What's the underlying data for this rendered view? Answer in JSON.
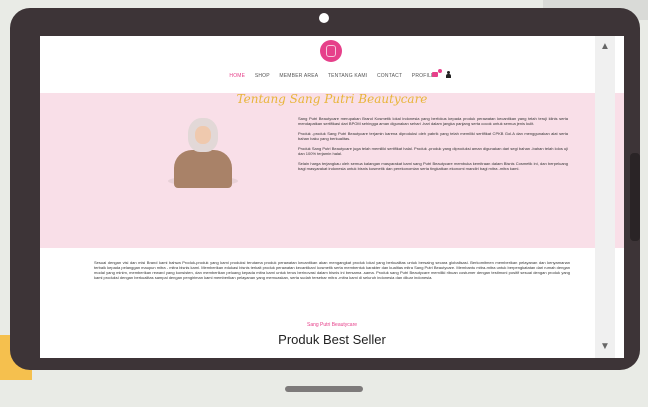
{
  "nav": {
    "items": [
      "HOME",
      "SHOP",
      "MEMBER AREA",
      "TENTANG KAMI",
      "CONTACT",
      "PROFILE"
    ],
    "active_index": 0
  },
  "about": {
    "title": "Tentang Sang Putri Beautycare",
    "paragraphs": [
      "Sang Putri Beautycare merupakan Brand Kosmetik lokal indonesia yang berfokus kepada produk perawatan kecantikan yang telah teruji klinis serta mendapatkan sertifikasi dari BPOM sehingga aman digunakan sehari -hari dalam jangka panjang serta cocok untuk semua jenis kulit.",
      "Produk -produk Sang Putri Beautycare terjamin karena diproduksi oleh pabrik yang telah memiliki sertifikat CPKB Gol.A dan menggunakan alat serta bahan baku yang berkualitas.",
      "Produk Sang Putri Beautycare juga telah memiliki sertifikat halal. Produk -produk yang diproduksi aman digunakan dari segi bahan -bahan telah lolos uji dan 100% terjamin halal.",
      "Selain harga terjangkau oleh semua kalangan masyarakat kami sang Putri Beautycare membuka kemitraan dalam Bisnis Cosmetik ini, dan berpeluang bagi masyarakat indonesia untuk bisnis kosmetik dan perekonomian serta tingkatkan ekonomi mandiri bagi mitra -mitra kami."
    ],
    "mission": "Sesuai dengan visi dan misi Brand kami bahwa Produk-produk yang kami produksi terutama produk perawatan kecantikan akan mengangkat produk lokal yang berkualitas untuk bersaing secara globalisasi. Berkomitmen memberikan pelayanan dan kenyamanan terbaik kepada pelanggan maupun mitra - mitra bisnis kami. Memberikan edukasi bisnis terkait produk perawatan kecantikan/ kosmetik serta membentuk karakter dan kualitas mitra Sang Putri Beautycare. Membantu mitra-mitra untuk berpengkatatan dari rumah dengan modal yang minim, memberikan reward yang konsisten, dan memberikan peluang kepada mitra kami untuk terus berinovasi dalam bisnis ini bersama -sama. Produk sang Putri Beautycare memiliki ribuan costumer dengan testimoni positif sesuai dengan produk yang kami produksi dengan berkualitas sampai dengan pengiriman kami memberikan pelayanan yang memuaskan, serta sudah tersebar mitra -mitra kami di seluruh indonesia dan diluar indonesia."
  },
  "products": {
    "subtitle": "Sang Putri Beautycare",
    "title": "Produk Best Seller"
  },
  "colors": {
    "accent": "#e6408a",
    "band": "#f9dfe8",
    "script": "#e8b53a",
    "bezel": "#3d3437"
  }
}
